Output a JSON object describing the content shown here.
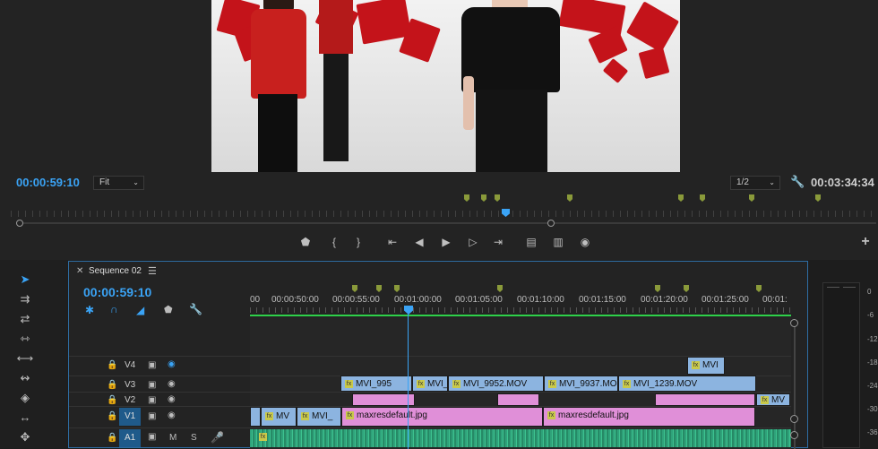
{
  "monitor": {
    "timecode_current": "00:00:59:10",
    "fit_dropdown": "Fit",
    "resolution_dropdown": "1/2",
    "timecode_duration": "00:03:34:34"
  },
  "transport": {
    "marker": "marker-icon",
    "in_point": "{",
    "out_point": "}",
    "go_to_in": "go-to-in-icon",
    "step_back": "step-back-icon",
    "play": "play-icon",
    "step_forward": "step-forward-icon",
    "go_to_out": "go-to-out-icon",
    "lift": "lift-icon",
    "extract": "extract-icon",
    "export_frame": "camera-icon",
    "add": "+"
  },
  "timeline": {
    "tab_title": "Sequence 02",
    "timecode": "00:00:59:10",
    "ruler": [
      "00",
      "00:00:50:00",
      "00:00:55:00",
      "00:01:00:00",
      "00:01:05:00",
      "00:01:10:00",
      "00:01:15:00",
      "00:01:20:00",
      "00:01:25:00",
      "00:01:"
    ],
    "tracks": [
      {
        "name": "V4"
      },
      {
        "name": "V3"
      },
      {
        "name": "V2"
      },
      {
        "name": "V1",
        "target": true
      },
      {
        "name": "A1",
        "target": true,
        "m": "M",
        "s": "S"
      }
    ],
    "clips": {
      "v4_1": "MVI",
      "v3_1": "MVI_995",
      "v3_2": "MVI_",
      "v3_3": "MVI_9952.MOV",
      "v3_4": "MVI_9937.MO",
      "v3_5": "MVI_1239.MOV",
      "v2_1": "MV",
      "v1_1": "MV",
      "v1_2": "MVI_",
      "v1_3": "maxresdefault.jpg",
      "v1_4": "maxresdefault.jpg"
    }
  },
  "meter": {
    "scale": [
      "0",
      "-6",
      "-12",
      "-18",
      "-24",
      "-30",
      "-36"
    ]
  },
  "colors": {
    "accent_blue": "#3aa3f5",
    "clip_video": "#8cb4e0",
    "clip_image": "#e08fd8",
    "audio_green": "#2fa27a",
    "marker": "#8a9a3a"
  }
}
